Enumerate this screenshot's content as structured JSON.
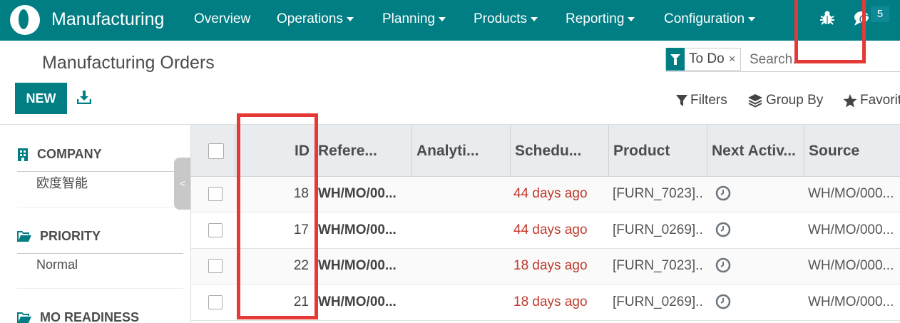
{
  "navbar": {
    "app_name": "Manufacturing",
    "menus": [
      "Overview",
      "Operations",
      "Planning",
      "Products",
      "Reporting",
      "Configuration"
    ],
    "chat_count": "5"
  },
  "page": {
    "title": "Manufacturing Orders",
    "new_label": "NEW"
  },
  "search": {
    "facet_label": "To Do",
    "facet_close": "×",
    "placeholder": "Search..."
  },
  "controls": {
    "filters": "Filters",
    "group_by": "Group By",
    "favorites": "Favorit"
  },
  "sidebar": {
    "sections": [
      {
        "title": "COMPANY",
        "value": "欧度智能"
      },
      {
        "title": "PRIORITY",
        "value": "Normal"
      },
      {
        "title": "MO READINESS",
        "value": ""
      }
    ],
    "collapse_glyph": "<"
  },
  "table": {
    "columns": [
      "ID",
      "Refere...",
      "Analyti...",
      "Schedu...",
      "Product",
      "Next Activ...",
      "Source"
    ],
    "rows": [
      {
        "id": "18",
        "reference": "WH/MO/00...",
        "analytic": "",
        "scheduled": "44 days ago",
        "product": "[FURN_7023]...",
        "source": "WH/MO/000..."
      },
      {
        "id": "17",
        "reference": "WH/MO/00...",
        "analytic": "",
        "scheduled": "44 days ago",
        "product": "[FURN_0269]...",
        "source": "WH/MO/000..."
      },
      {
        "id": "22",
        "reference": "WH/MO/00...",
        "analytic": "",
        "scheduled": "18 days ago",
        "product": "[FURN_7023]...",
        "source": "WH/MO/000..."
      },
      {
        "id": "21",
        "reference": "WH/MO/00...",
        "analytic": "",
        "scheduled": "18 days ago",
        "product": "[FURN_0269]...",
        "source": "WH/MO/000..."
      }
    ]
  },
  "colors": {
    "brand": "#017e84",
    "overdue": "#c0392b",
    "highlight": "#e53935"
  }
}
